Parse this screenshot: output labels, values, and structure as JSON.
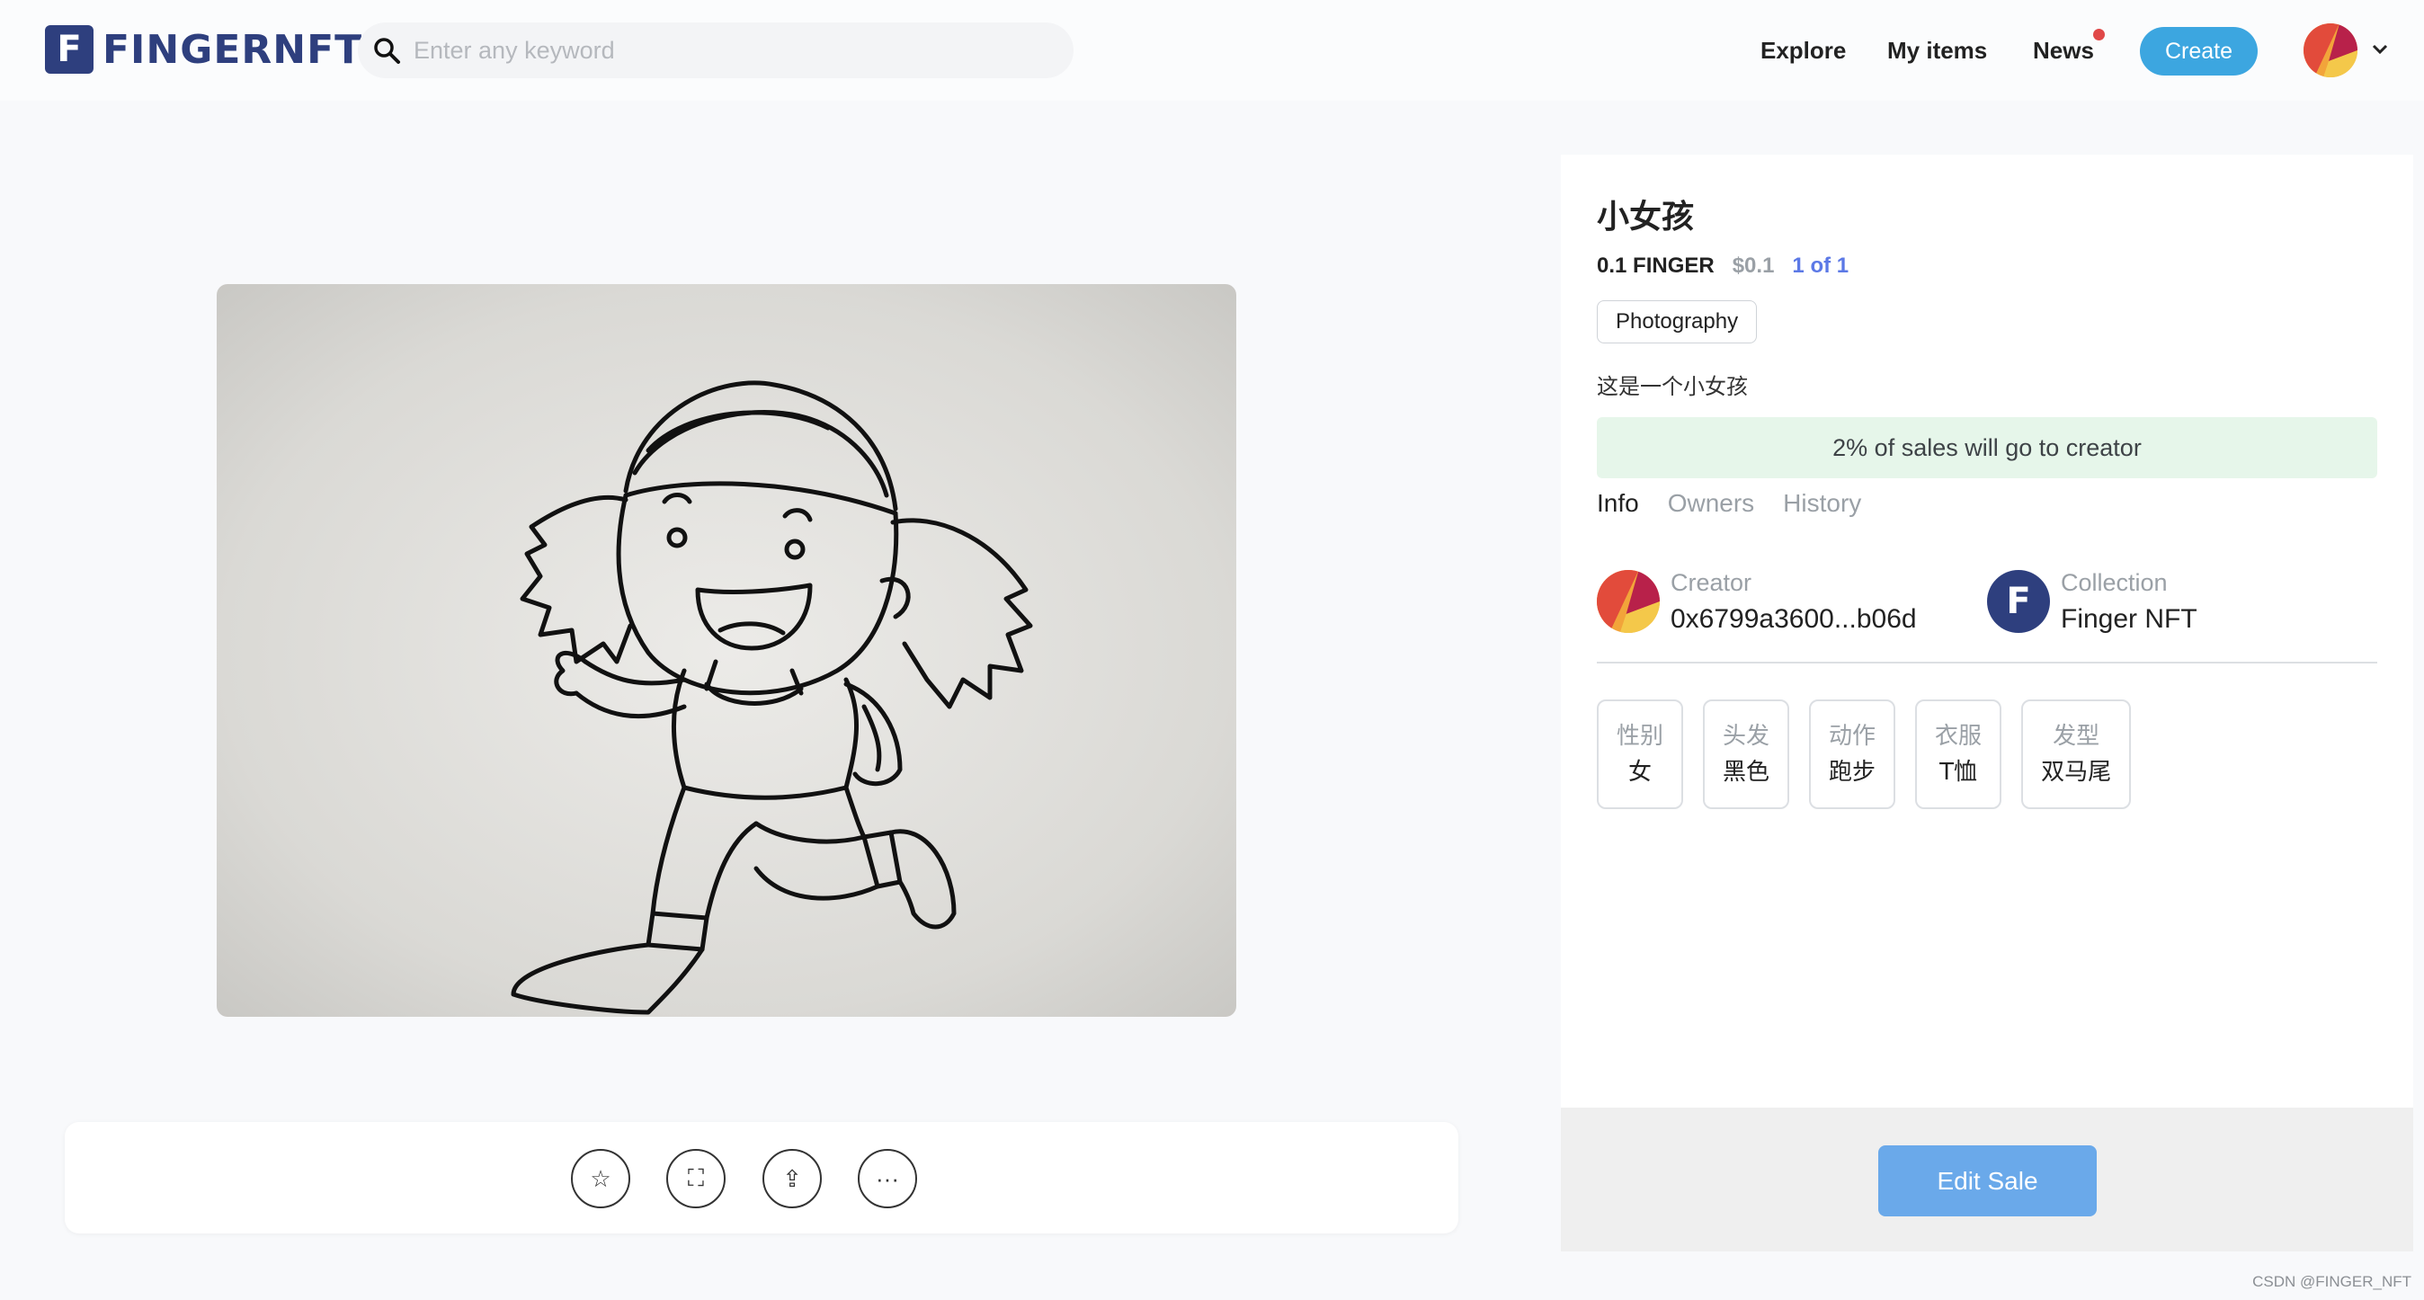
{
  "header": {
    "logo_text": "FINGERNFT",
    "logo_mark": "F",
    "search_placeholder": "Enter any keyword",
    "nav": {
      "explore": "Explore",
      "my_items": "My items",
      "news": "News"
    },
    "create_label": "Create"
  },
  "artwork": {
    "alt": "小女孩"
  },
  "actions": {
    "favorite_icon": "☆",
    "fullscreen_icon": "⛶",
    "share_icon": "⇪",
    "more_icon": "···"
  },
  "item": {
    "title": "小女孩",
    "price": "0.1 FINGER",
    "price_usd": "$0.1",
    "edition": "1 of 1",
    "category": "Photography",
    "description": "这是一个小女孩",
    "royalty": "2% of sales will go to creator",
    "tabs": [
      "Info",
      "Owners",
      "History"
    ],
    "creator_label": "Creator",
    "creator_value": "0x6799a3600...b06d",
    "collection_label": "Collection",
    "collection_value": "Finger NFT",
    "attributes": [
      {
        "key": "性别",
        "value": "女"
      },
      {
        "key": "头发",
        "value": "黑色"
      },
      {
        "key": "动作",
        "value": "跑步"
      },
      {
        "key": "衣服",
        "value": "T恤"
      },
      {
        "key": "发型",
        "value": "双马尾"
      }
    ],
    "edit_sale": "Edit Sale"
  },
  "watermark": "CSDN @FINGER_NFT",
  "colors": {
    "brand": "#2e3f7e",
    "accent": "#3ca6e0",
    "edition": "#5c79e6",
    "royalty_bg": "#e6f6ea",
    "edit_sale": "#6aa9ea",
    "news_dot": "#e04848"
  }
}
